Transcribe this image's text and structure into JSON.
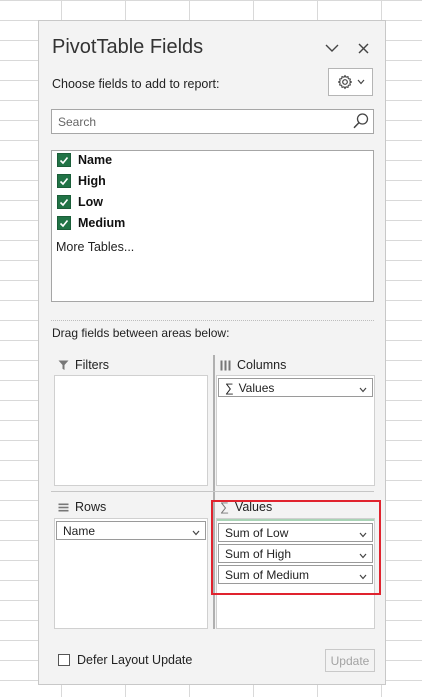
{
  "pane": {
    "title": "PivotTable Fields",
    "choose_label": "Choose fields to add to report:",
    "settings_icon": "gear-icon",
    "collapse_icon": "chevron-down-icon",
    "close_icon": "close-icon"
  },
  "search": {
    "placeholder": "Search"
  },
  "fields": [
    {
      "label": "Name",
      "checked": true
    },
    {
      "label": "High",
      "checked": true
    },
    {
      "label": "Low",
      "checked": true
    },
    {
      "label": "Medium",
      "checked": true
    }
  ],
  "more_tables": "More Tables...",
  "drag_label": "Drag fields between areas below:",
  "areas": {
    "filters": {
      "label": "Filters",
      "items": []
    },
    "columns": {
      "label": "Columns",
      "items": [
        "Values"
      ]
    },
    "rows": {
      "label": "Rows",
      "items": [
        "Name"
      ]
    },
    "values": {
      "label": "Values",
      "items": [
        "Sum of Low",
        "Sum of High",
        "Sum of Medium"
      ]
    }
  },
  "defer_label": "Defer Layout Update",
  "update_label": "Update",
  "colors": {
    "accent": "#217346",
    "highlight": "#e0232e"
  }
}
